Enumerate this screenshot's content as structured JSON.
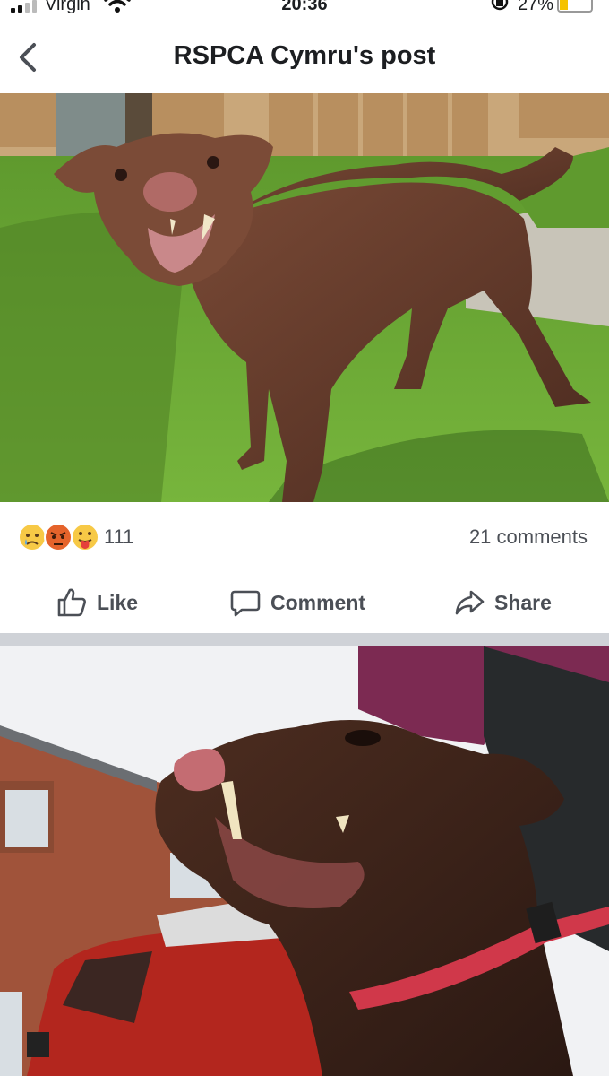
{
  "status_bar": {
    "carrier": "Virgin",
    "time": "20:36",
    "battery": "27%",
    "icons": [
      "signal-icon",
      "wifi-icon",
      "rotation-lock-icon",
      "battery-icon"
    ]
  },
  "header": {
    "title": "RSPCA Cymru's post",
    "back_icon": "chevron-left-icon"
  },
  "post": {
    "reactions": {
      "emojis": [
        "sad-reaction-icon",
        "angry-reaction-icon",
        "care-reaction-icon"
      ],
      "count": "111"
    },
    "comments_count": "21 comments",
    "actions": {
      "like_label": "Like",
      "comment_label": "Comment",
      "share_label": "Share"
    }
  },
  "colors": {
    "header_text": "#1c1e21",
    "secondary_text": "#4b4f56",
    "separator": "#cfd2d7",
    "battery_fill": "#f5c200"
  }
}
